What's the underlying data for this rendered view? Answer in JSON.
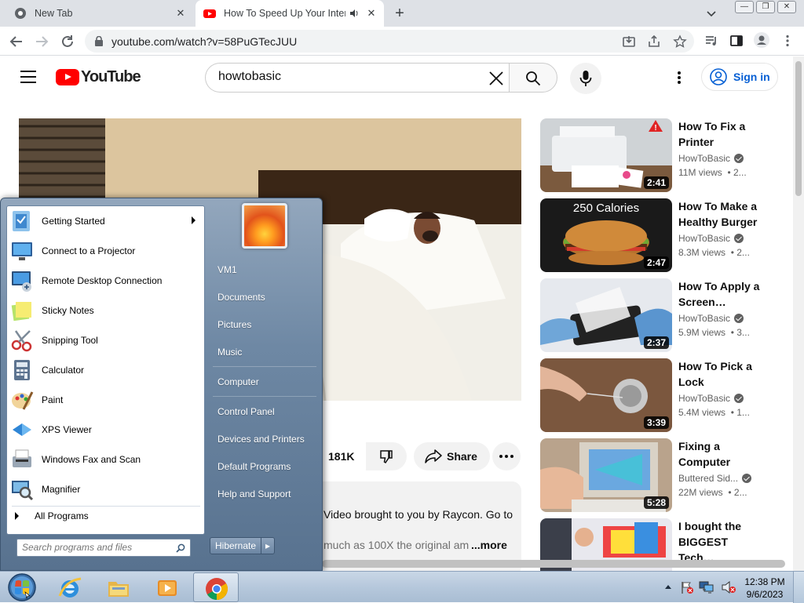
{
  "browser": {
    "tabs": [
      {
        "title": "New Tab",
        "icon": "chrome-icon"
      },
      {
        "title": "How To Speed Up Your Internet",
        "icon": "youtube-icon",
        "audio": true
      }
    ],
    "url": "youtube.com/watch?v=58PuGTecJUU"
  },
  "youtube": {
    "logo": "YouTube",
    "search_value": "howtobasic",
    "signin": "Sign in",
    "likes": "181K",
    "share": "Share",
    "description": {
      "line1": "Video brought to you by Raycon. Go to",
      "line2": "much as 100X the original am",
      "more": "...more"
    },
    "related": [
      {
        "title": "How To Fix a Printer",
        "channel": "HowToBasic",
        "views": "11M views",
        "age": "• 2...",
        "duration": "2:41"
      },
      {
        "title": "How To Make a Healthy Burger",
        "channel": "HowToBasic",
        "views": "8.3M views",
        "age": "• 2...",
        "duration": "2:47",
        "thumb_text": "250 Calories"
      },
      {
        "title": "How To Apply a Screen…",
        "channel": "HowToBasic",
        "views": "5.9M views",
        "age": "• 3...",
        "duration": "2:37"
      },
      {
        "title": "How To Pick a Lock",
        "channel": "HowToBasic",
        "views": "5.4M views",
        "age": "• 1...",
        "duration": "3:39"
      },
      {
        "title": "Fixing a Computer",
        "channel": "Buttered Sid...",
        "views": "22M views",
        "age": "• 2...",
        "duration": "5:28"
      },
      {
        "title": "I bought the BIGGEST Tech…",
        "channel": "",
        "views": "",
        "age": "",
        "duration": ""
      }
    ]
  },
  "start_menu": {
    "programs": [
      {
        "label": "Getting Started",
        "submenu": true,
        "color": "#4a8fd9"
      },
      {
        "label": "Connect to a Projector",
        "color": "#3a7bc8"
      },
      {
        "label": "Remote Desktop Connection",
        "color": "#2f6eb5"
      },
      {
        "label": "Sticky Notes",
        "color": "#e6d84a"
      },
      {
        "label": "Snipping Tool",
        "color": "#c94040"
      },
      {
        "label": "Calculator",
        "color": "#6d8fb0"
      },
      {
        "label": "Paint",
        "color": "#e08a2c"
      },
      {
        "label": "XPS Viewer",
        "color": "#3b8ed6"
      },
      {
        "label": "Windows Fax and Scan",
        "color": "#8a9aab"
      },
      {
        "label": "Magnifier",
        "color": "#5a7fa8"
      }
    ],
    "all_programs": "All Programs",
    "search_placeholder": "Search programs and files",
    "right_links": [
      "VM1",
      "Documents",
      "Pictures",
      "Music",
      "Computer",
      "Control Panel",
      "Devices and Printers",
      "Default Programs",
      "Help and Support"
    ],
    "shutdown": "Hibernate"
  },
  "taskbar": {
    "time": "12:38 PM",
    "date": "9/6/2023",
    "apps": [
      "internet-explorer-icon",
      "windows-explorer-icon",
      "media-player-icon",
      "chrome-icon"
    ]
  }
}
